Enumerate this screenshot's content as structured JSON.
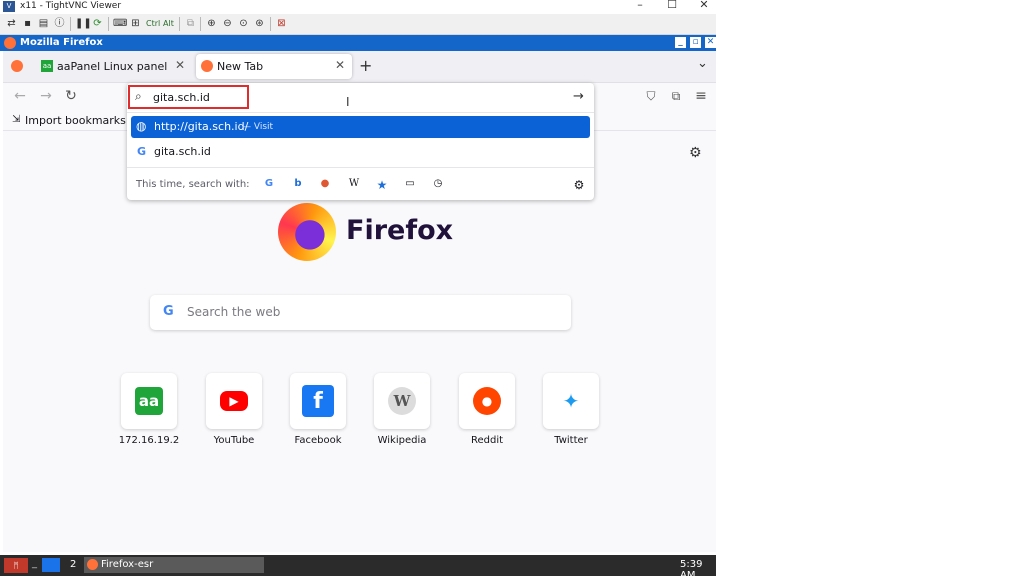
{
  "vnc": {
    "title": "x11 - TightVNC Viewer",
    "toolbar_text": {
      "ctrl": "Ctrl",
      "alt": "Alt"
    }
  },
  "firefox_window": {
    "title": "Mozilla Firefox"
  },
  "tabs": [
    {
      "label": "aaPanel Linux panel",
      "active": false
    },
    {
      "label": "New Tab",
      "active": true
    }
  ],
  "urlbar": {
    "value": "gita.sch.id",
    "suggestions": [
      {
        "text": "http://gita.sch.id/",
        "action": "— Visit",
        "selected": true,
        "icon": "globe-icon"
      },
      {
        "text": "gita.sch.id",
        "action": "",
        "selected": false,
        "icon": "google-icon"
      }
    ],
    "search_with_label": "This time, search with:",
    "engines": [
      "google-icon",
      "bing-icon",
      "duckduckgo-icon",
      "wikipedia-icon",
      "bookmarks-icon",
      "tabs-icon",
      "history-icon"
    ]
  },
  "bookmarks": {
    "import_label": "Import bookmarks..."
  },
  "newtab": {
    "brand": "Firefox",
    "search_placeholder": "Search the web",
    "top_sites": [
      {
        "label": "172.16.19.2",
        "glyph": "aa",
        "color": "#20a53a"
      },
      {
        "label": "YouTube",
        "glyph": "▶",
        "color": "#ff0000"
      },
      {
        "label": "Facebook",
        "glyph": "f",
        "color": "#1877f2"
      },
      {
        "label": "Wikipedia",
        "glyph": "W",
        "color": "#9aa0a6"
      },
      {
        "label": "Reddit",
        "glyph": "●",
        "color": "#ff4500"
      },
      {
        "label": "Twitter",
        "glyph": "✦",
        "color": "#1d9bf0"
      }
    ]
  },
  "taskbar": {
    "workspace": "2",
    "task_label": "Firefox-esr",
    "clock": "5:39 AM"
  },
  "colors": {
    "accent": "#1466c8",
    "selected_row": "#0b62d6",
    "highlight_box": "#e02c2c"
  }
}
